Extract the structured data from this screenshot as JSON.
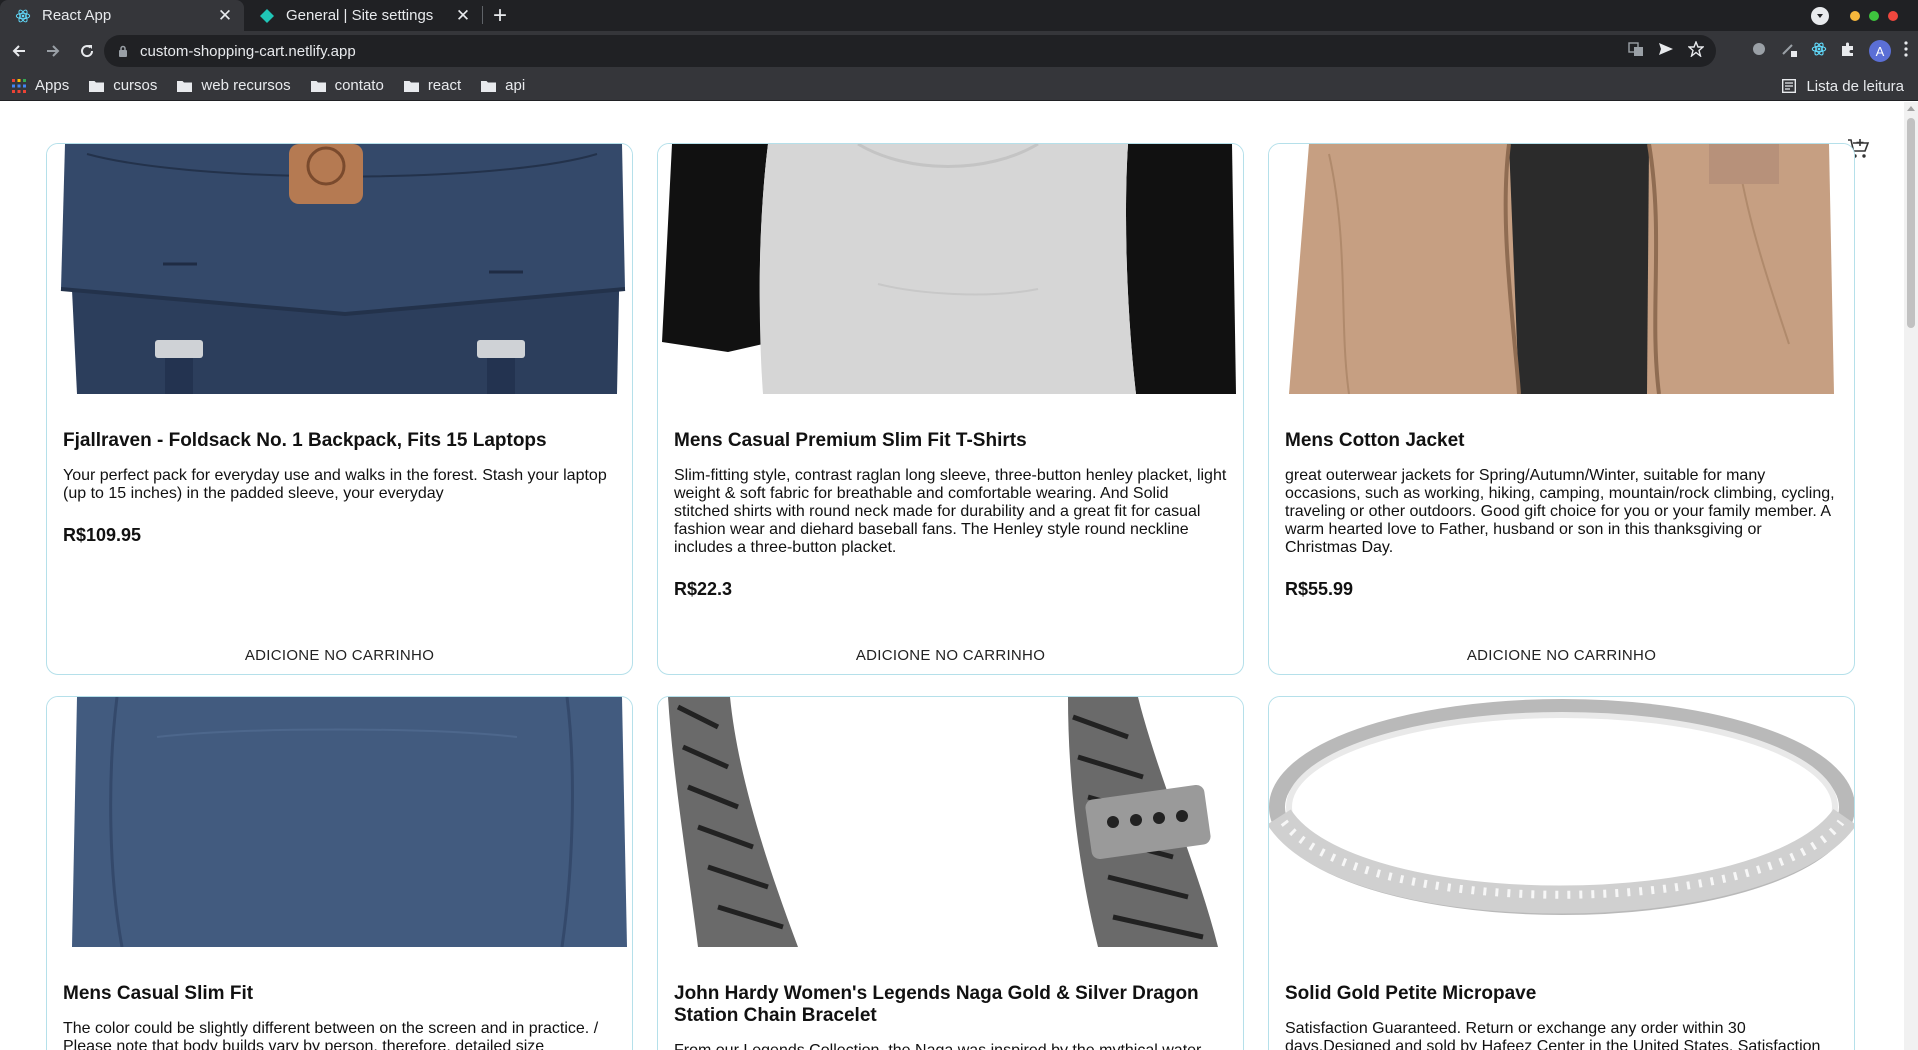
{
  "browser": {
    "tabs": [
      {
        "title": "React App",
        "icon": "react-icon",
        "active": true
      },
      {
        "title": "General | Site settings",
        "icon": "netlify-icon",
        "active": false
      }
    ],
    "url": "custom-shopping-cart.netlify.app",
    "bookmarks": [
      {
        "label": "Apps",
        "icon": "apps-grid-icon"
      },
      {
        "label": "cursos",
        "icon": "folder-icon"
      },
      {
        "label": "web recursos",
        "icon": "folder-icon"
      },
      {
        "label": "contato",
        "icon": "folder-icon"
      },
      {
        "label": "react",
        "icon": "folder-icon"
      },
      {
        "label": "api",
        "icon": "folder-icon"
      }
    ],
    "reading_list": "Lista de leitura",
    "avatar_letter": "A"
  },
  "store": {
    "add_label": "ADICIONE NO CARRINHO",
    "products": [
      {
        "title": "Fjallraven - Foldsack No. 1 Backpack, Fits 15 Laptops",
        "description": "Your perfect pack for everyday use and walks in the forest. Stash your laptop (up to 15 inches) in the padded sleeve, your everyday",
        "price": "R$109.95"
      },
      {
        "title": "Mens Casual Premium Slim Fit T-Shirts",
        "description": "Slim-fitting style, contrast raglan long sleeve, three-button henley placket, light weight & soft fabric for breathable and comfortable wearing. And Solid stitched shirts with round neck made for durability and a great fit for casual fashion wear and diehard baseball fans. The Henley style round neckline includes a three-button placket.",
        "price": "R$22.3"
      },
      {
        "title": "Mens Cotton Jacket",
        "description": "great outerwear jackets for Spring/Autumn/Winter, suitable for many occasions, such as working, hiking, camping, mountain/rock climbing, cycling, traveling or other outdoors. Good gift choice for you or your family member. A warm hearted love to Father, husband or son in this thanksgiving or Christmas Day.",
        "price": "R$55.99"
      },
      {
        "title": "Mens Casual Slim Fit",
        "description": "The color could be slightly different between on the screen and in practice. / Please note that body builds vary by person, therefore, detailed size",
        "price": ""
      },
      {
        "title": "John Hardy Women's Legends Naga Gold & Silver Dragon Station Chain Bracelet",
        "description": "From our Legends Collection, the Naga was inspired by the mythical water",
        "price": ""
      },
      {
        "title": "Solid Gold Petite Micropave",
        "description": "Satisfaction Guaranteed. Return or exchange any order within 30 days.Designed and sold by Hafeez Center in the United States. Satisfaction",
        "price": ""
      }
    ]
  }
}
